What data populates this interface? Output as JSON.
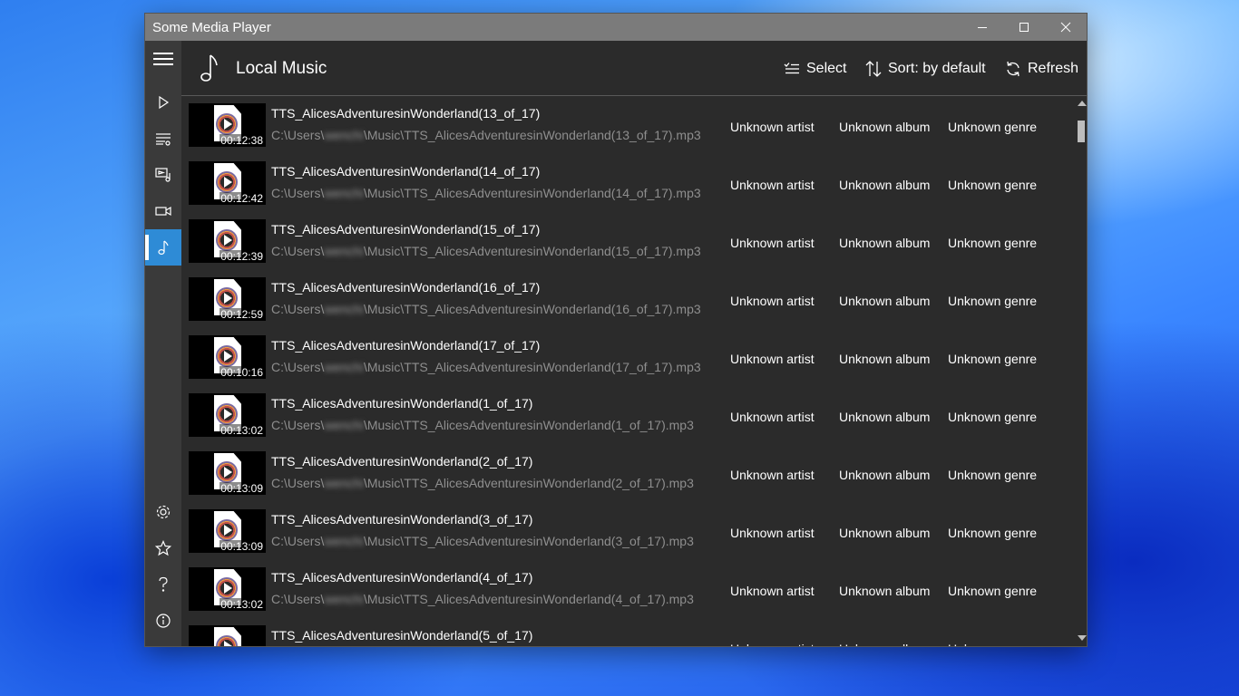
{
  "window": {
    "title": "Some Media Player",
    "controls": {
      "minimize": "minimize-icon",
      "maximize": "maximize-icon",
      "close": "close-icon"
    }
  },
  "sidebar": {
    "top_items": [
      {
        "id": "menu",
        "icon": "hamburger-icon"
      },
      {
        "id": "now-playing",
        "icon": "play-icon"
      },
      {
        "id": "playlists",
        "icon": "playlist-icon"
      },
      {
        "id": "library",
        "icon": "media-library-icon"
      },
      {
        "id": "video",
        "icon": "video-camera-icon"
      },
      {
        "id": "music",
        "icon": "music-note-icon",
        "active": true
      }
    ],
    "bottom_items": [
      {
        "id": "settings",
        "icon": "gear-icon"
      },
      {
        "id": "favorites",
        "icon": "star-icon"
      },
      {
        "id": "help",
        "icon": "question-icon"
      },
      {
        "id": "about",
        "icon": "info-icon"
      }
    ]
  },
  "header": {
    "icon": "music-note-icon",
    "title": "Local Music",
    "select_label": "Select",
    "sort_label": "Sort: by default",
    "refresh_label": "Refresh"
  },
  "colors": {
    "accent": "#2e8bd6",
    "background": "#2b2b2b",
    "sidebar": "#3a3a3a",
    "titlebar": "#7b7b7b"
  },
  "tracks": [
    {
      "name": "TTS_AlicesAdventuresinWonderland(13_of_17)",
      "path_prefix": "C:\\Users\\",
      "path_user": "wenchi",
      "path_suffix": "\\Music\\TTS_AlicesAdventuresinWonderland(13_of_17).mp3",
      "duration": "00:12:38",
      "artist": "Unknown artist",
      "album": "Unknown album",
      "genre": "Unknown genre"
    },
    {
      "name": "TTS_AlicesAdventuresinWonderland(14_of_17)",
      "path_prefix": "C:\\Users\\",
      "path_user": "wenchi",
      "path_suffix": "\\Music\\TTS_AlicesAdventuresinWonderland(14_of_17).mp3",
      "duration": "00:12:42",
      "artist": "Unknown artist",
      "album": "Unknown album",
      "genre": "Unknown genre"
    },
    {
      "name": "TTS_AlicesAdventuresinWonderland(15_of_17)",
      "path_prefix": "C:\\Users\\",
      "path_user": "wenchi",
      "path_suffix": "\\Music\\TTS_AlicesAdventuresinWonderland(15_of_17).mp3",
      "duration": "00:12:39",
      "artist": "Unknown artist",
      "album": "Unknown album",
      "genre": "Unknown genre"
    },
    {
      "name": "TTS_AlicesAdventuresinWonderland(16_of_17)",
      "path_prefix": "C:\\Users\\",
      "path_user": "wenchi",
      "path_suffix": "\\Music\\TTS_AlicesAdventuresinWonderland(16_of_17).mp3",
      "duration": "00:12:59",
      "artist": "Unknown artist",
      "album": "Unknown album",
      "genre": "Unknown genre"
    },
    {
      "name": "TTS_AlicesAdventuresinWonderland(17_of_17)",
      "path_prefix": "C:\\Users\\",
      "path_user": "wenchi",
      "path_suffix": "\\Music\\TTS_AlicesAdventuresinWonderland(17_of_17).mp3",
      "duration": "00:10:16",
      "artist": "Unknown artist",
      "album": "Unknown album",
      "genre": "Unknown genre"
    },
    {
      "name": "TTS_AlicesAdventuresinWonderland(1_of_17)",
      "path_prefix": "C:\\Users\\",
      "path_user": "wenchi",
      "path_suffix": "\\Music\\TTS_AlicesAdventuresinWonderland(1_of_17).mp3",
      "duration": "00:13:02",
      "artist": "Unknown artist",
      "album": "Unknown album",
      "genre": "Unknown genre"
    },
    {
      "name": "TTS_AlicesAdventuresinWonderland(2_of_17)",
      "path_prefix": "C:\\Users\\",
      "path_user": "wenchi",
      "path_suffix": "\\Music\\TTS_AlicesAdventuresinWonderland(2_of_17).mp3",
      "duration": "00:13:09",
      "artist": "Unknown artist",
      "album": "Unknown album",
      "genre": "Unknown genre"
    },
    {
      "name": "TTS_AlicesAdventuresinWonderland(3_of_17)",
      "path_prefix": "C:\\Users\\",
      "path_user": "wenchi",
      "path_suffix": "\\Music\\TTS_AlicesAdventuresinWonderland(3_of_17).mp3",
      "duration": "00:13:09",
      "artist": "Unknown artist",
      "album": "Unknown album",
      "genre": "Unknown genre"
    },
    {
      "name": "TTS_AlicesAdventuresinWonderland(4_of_17)",
      "path_prefix": "C:\\Users\\",
      "path_user": "wenchi",
      "path_suffix": "\\Music\\TTS_AlicesAdventuresinWonderland(4_of_17).mp3",
      "duration": "00:13:02",
      "artist": "Unknown artist",
      "album": "Unknown album",
      "genre": "Unknown genre"
    },
    {
      "name": "TTS_AlicesAdventuresinWonderland(5_of_17)",
      "path_prefix": "",
      "path_user": "",
      "path_suffix": "",
      "duration": "",
      "artist": "Unknown artist",
      "album": "Unknown album",
      "genre": "Unknown genre"
    }
  ]
}
